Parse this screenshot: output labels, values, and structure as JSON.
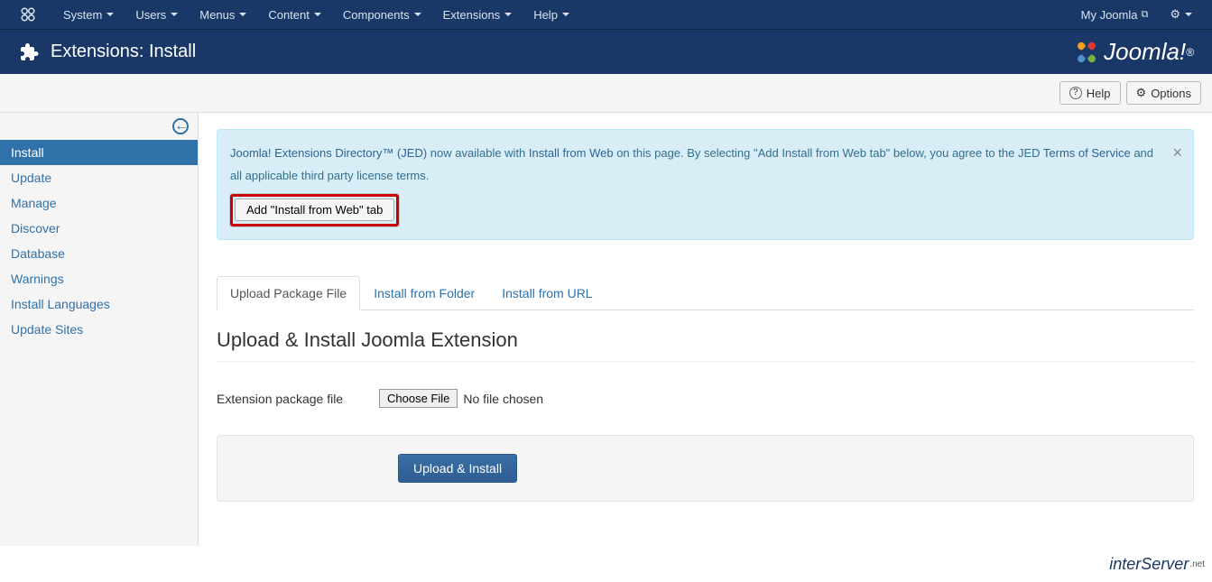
{
  "topnav": {
    "items": [
      "System",
      "Users",
      "Menus",
      "Content",
      "Components",
      "Extensions",
      "Help"
    ],
    "site_link": "My Joomla"
  },
  "header": {
    "title": "Extensions: Install",
    "brand": "Joomla!"
  },
  "toolbar": {
    "help": "Help",
    "options": "Options"
  },
  "sidebar": {
    "items": [
      "Install",
      "Update",
      "Manage",
      "Discover",
      "Database",
      "Warnings",
      "Install Languages",
      "Update Sites"
    ],
    "active_index": 0
  },
  "alert": {
    "link1": "Joomla! Extensions Directory™ (JED)",
    "text1": " now available with ",
    "link2": "Install from Web",
    "text2": " on this page.  By selecting \"Add Install from Web tab\" below, you agree to the JED ",
    "link3": "Terms of Service",
    "text3": " and all applicable third party license terms.",
    "button": "Add \"Install from Web\" tab"
  },
  "tabs": {
    "items": [
      "Upload Package File",
      "Install from Folder",
      "Install from URL"
    ],
    "active_index": 0
  },
  "main": {
    "heading": "Upload & Install Joomla Extension",
    "label": "Extension package file",
    "choose_btn": "Choose File",
    "no_file": "No file chosen",
    "submit": "Upload & Install"
  },
  "footer": {
    "brand": "interServer",
    "suffix": ".net"
  }
}
